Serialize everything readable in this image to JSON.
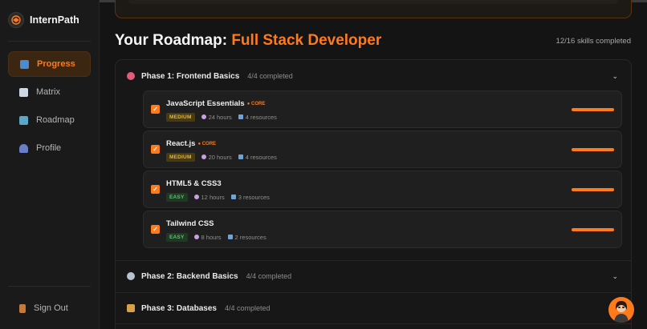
{
  "brand": {
    "name": "InternPath"
  },
  "nav": [
    {
      "label": "Progress",
      "icon": "bar-chart-icon",
      "active": true
    },
    {
      "label": "Matrix",
      "icon": "line-chart-icon",
      "active": false
    },
    {
      "label": "Roadmap",
      "icon": "map-icon",
      "active": false
    },
    {
      "label": "Profile",
      "icon": "user-icon",
      "active": false
    }
  ],
  "signout": {
    "label": "Sign Out",
    "icon": "door-icon"
  },
  "header": {
    "title_prefix": "Your Roadmap:",
    "title_accent": "Full Stack Developer",
    "skills_completed": "12/16 skills completed"
  },
  "phases": [
    {
      "name": "Phase 1: Frontend Basics",
      "count": "4/4 completed",
      "icon": "palette-icon",
      "expanded": true
    },
    {
      "name": "Phase 2: Backend Basics",
      "count": "4/4 completed",
      "icon": "gear-icon",
      "expanded": false
    },
    {
      "name": "Phase 3: Databases",
      "count": "4/4 completed",
      "icon": "database-icon",
      "expanded": false
    }
  ],
  "skills": [
    {
      "name": "JavaScript Essentials",
      "core": "● CORE",
      "difficulty": "MEDIUM",
      "hours": "24 hours",
      "resources": "4 resources",
      "checked": true,
      "progress": 1.0
    },
    {
      "name": "React.js",
      "core": "● CORE",
      "difficulty": "MEDIUM",
      "hours": "20 hours",
      "resources": "4 resources",
      "checked": true,
      "progress": 1.0
    },
    {
      "name": "HTML5 & CSS3",
      "core": "",
      "difficulty": "EASY",
      "hours": "12 hours",
      "resources": "3 resources",
      "checked": true,
      "progress": 1.0
    },
    {
      "name": "Tailwind CSS",
      "core": "",
      "difficulty": "EASY",
      "hours": "8 hours",
      "resources": "2 resources",
      "checked": true,
      "progress": 1.0
    }
  ],
  "colors": {
    "accent": "#ff7a1a",
    "medium": "#e3b63a",
    "easy": "#57c46a"
  }
}
